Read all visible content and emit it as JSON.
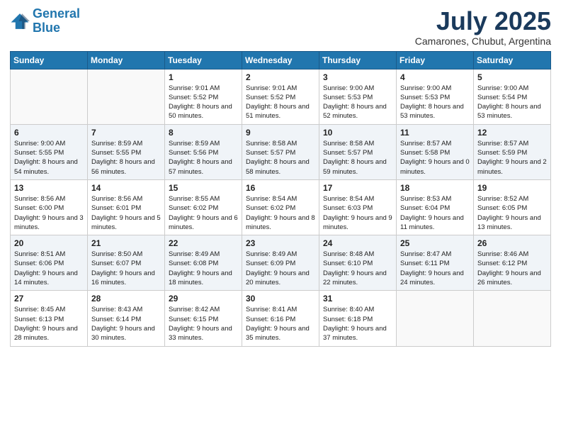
{
  "logo": {
    "line1": "General",
    "line2": "Blue"
  },
  "title": "July 2025",
  "subtitle": "Camarones, Chubut, Argentina",
  "days_header": [
    "Sunday",
    "Monday",
    "Tuesday",
    "Wednesday",
    "Thursday",
    "Friday",
    "Saturday"
  ],
  "weeks": [
    [
      {
        "day": "",
        "info": ""
      },
      {
        "day": "",
        "info": ""
      },
      {
        "day": "1",
        "info": "Sunrise: 9:01 AM\nSunset: 5:52 PM\nDaylight: 8 hours and 50 minutes."
      },
      {
        "day": "2",
        "info": "Sunrise: 9:01 AM\nSunset: 5:52 PM\nDaylight: 8 hours and 51 minutes."
      },
      {
        "day": "3",
        "info": "Sunrise: 9:00 AM\nSunset: 5:53 PM\nDaylight: 8 hours and 52 minutes."
      },
      {
        "day": "4",
        "info": "Sunrise: 9:00 AM\nSunset: 5:53 PM\nDaylight: 8 hours and 53 minutes."
      },
      {
        "day": "5",
        "info": "Sunrise: 9:00 AM\nSunset: 5:54 PM\nDaylight: 8 hours and 53 minutes."
      }
    ],
    [
      {
        "day": "6",
        "info": "Sunrise: 9:00 AM\nSunset: 5:55 PM\nDaylight: 8 hours and 54 minutes."
      },
      {
        "day": "7",
        "info": "Sunrise: 8:59 AM\nSunset: 5:55 PM\nDaylight: 8 hours and 56 minutes."
      },
      {
        "day": "8",
        "info": "Sunrise: 8:59 AM\nSunset: 5:56 PM\nDaylight: 8 hours and 57 minutes."
      },
      {
        "day": "9",
        "info": "Sunrise: 8:58 AM\nSunset: 5:57 PM\nDaylight: 8 hours and 58 minutes."
      },
      {
        "day": "10",
        "info": "Sunrise: 8:58 AM\nSunset: 5:57 PM\nDaylight: 8 hours and 59 minutes."
      },
      {
        "day": "11",
        "info": "Sunrise: 8:57 AM\nSunset: 5:58 PM\nDaylight: 9 hours and 0 minutes."
      },
      {
        "day": "12",
        "info": "Sunrise: 8:57 AM\nSunset: 5:59 PM\nDaylight: 9 hours and 2 minutes."
      }
    ],
    [
      {
        "day": "13",
        "info": "Sunrise: 8:56 AM\nSunset: 6:00 PM\nDaylight: 9 hours and 3 minutes."
      },
      {
        "day": "14",
        "info": "Sunrise: 8:56 AM\nSunset: 6:01 PM\nDaylight: 9 hours and 5 minutes."
      },
      {
        "day": "15",
        "info": "Sunrise: 8:55 AM\nSunset: 6:02 PM\nDaylight: 9 hours and 6 minutes."
      },
      {
        "day": "16",
        "info": "Sunrise: 8:54 AM\nSunset: 6:02 PM\nDaylight: 9 hours and 8 minutes."
      },
      {
        "day": "17",
        "info": "Sunrise: 8:54 AM\nSunset: 6:03 PM\nDaylight: 9 hours and 9 minutes."
      },
      {
        "day": "18",
        "info": "Sunrise: 8:53 AM\nSunset: 6:04 PM\nDaylight: 9 hours and 11 minutes."
      },
      {
        "day": "19",
        "info": "Sunrise: 8:52 AM\nSunset: 6:05 PM\nDaylight: 9 hours and 13 minutes."
      }
    ],
    [
      {
        "day": "20",
        "info": "Sunrise: 8:51 AM\nSunset: 6:06 PM\nDaylight: 9 hours and 14 minutes."
      },
      {
        "day": "21",
        "info": "Sunrise: 8:50 AM\nSunset: 6:07 PM\nDaylight: 9 hours and 16 minutes."
      },
      {
        "day": "22",
        "info": "Sunrise: 8:49 AM\nSunset: 6:08 PM\nDaylight: 9 hours and 18 minutes."
      },
      {
        "day": "23",
        "info": "Sunrise: 8:49 AM\nSunset: 6:09 PM\nDaylight: 9 hours and 20 minutes."
      },
      {
        "day": "24",
        "info": "Sunrise: 8:48 AM\nSunset: 6:10 PM\nDaylight: 9 hours and 22 minutes."
      },
      {
        "day": "25",
        "info": "Sunrise: 8:47 AM\nSunset: 6:11 PM\nDaylight: 9 hours and 24 minutes."
      },
      {
        "day": "26",
        "info": "Sunrise: 8:46 AM\nSunset: 6:12 PM\nDaylight: 9 hours and 26 minutes."
      }
    ],
    [
      {
        "day": "27",
        "info": "Sunrise: 8:45 AM\nSunset: 6:13 PM\nDaylight: 9 hours and 28 minutes."
      },
      {
        "day": "28",
        "info": "Sunrise: 8:43 AM\nSunset: 6:14 PM\nDaylight: 9 hours and 30 minutes."
      },
      {
        "day": "29",
        "info": "Sunrise: 8:42 AM\nSunset: 6:15 PM\nDaylight: 9 hours and 33 minutes."
      },
      {
        "day": "30",
        "info": "Sunrise: 8:41 AM\nSunset: 6:16 PM\nDaylight: 9 hours and 35 minutes."
      },
      {
        "day": "31",
        "info": "Sunrise: 8:40 AM\nSunset: 6:18 PM\nDaylight: 9 hours and 37 minutes."
      },
      {
        "day": "",
        "info": ""
      },
      {
        "day": "",
        "info": ""
      }
    ]
  ]
}
